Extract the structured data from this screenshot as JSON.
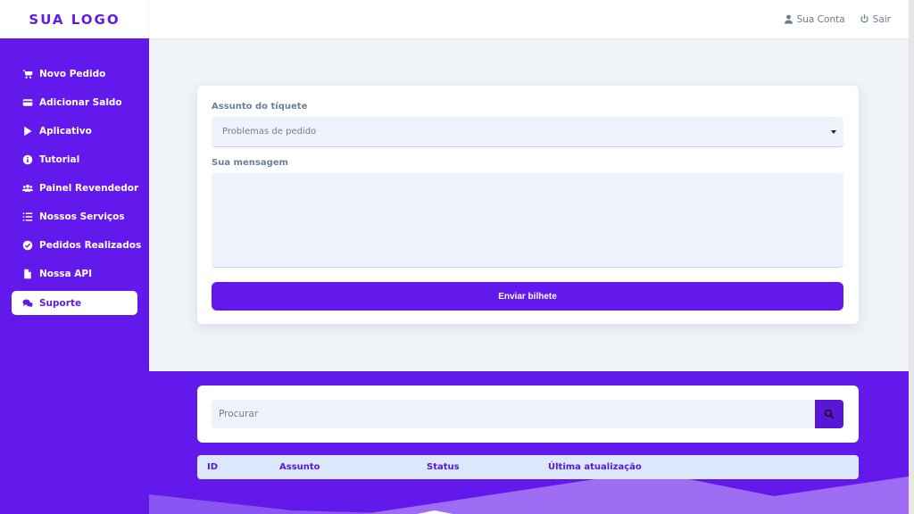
{
  "brand": {
    "logo": "SUA LOGO"
  },
  "sidebar": {
    "items": [
      {
        "label": "Novo Pedido",
        "icon": "cart-icon"
      },
      {
        "label": "Adicionar Saldo",
        "icon": "credit-card-icon"
      },
      {
        "label": "Aplicativo",
        "icon": "play-icon"
      },
      {
        "label": "Tutorial",
        "icon": "info-icon"
      },
      {
        "label": "Painel Revendedor",
        "icon": "users-icon"
      },
      {
        "label": "Nossos Serviços",
        "icon": "list-icon"
      },
      {
        "label": "Pedidos Realizados",
        "icon": "check-circle-icon"
      },
      {
        "label": "Nossa API",
        "icon": "file-icon"
      },
      {
        "label": "Suporte",
        "icon": "comments-icon",
        "active": true
      }
    ]
  },
  "topbar": {
    "account_label": "Sua Conta",
    "logout_label": "Sair"
  },
  "ticket_form": {
    "subject_label": "Assunto do tíquete",
    "subject_value": "Problemas de pedido",
    "message_label": "Sua mensagem",
    "message_value": "",
    "submit_label": "Enviar bilhete"
  },
  "search": {
    "placeholder": "Procurar"
  },
  "tickets_table": {
    "columns": [
      "ID",
      "Assunto",
      "Status",
      "Última atualização"
    ]
  },
  "colors": {
    "accent": "#6419ec",
    "background": "#f0f4f9",
    "input_bg": "#eef3fb",
    "table_header_bg": "#dbe7fb"
  }
}
